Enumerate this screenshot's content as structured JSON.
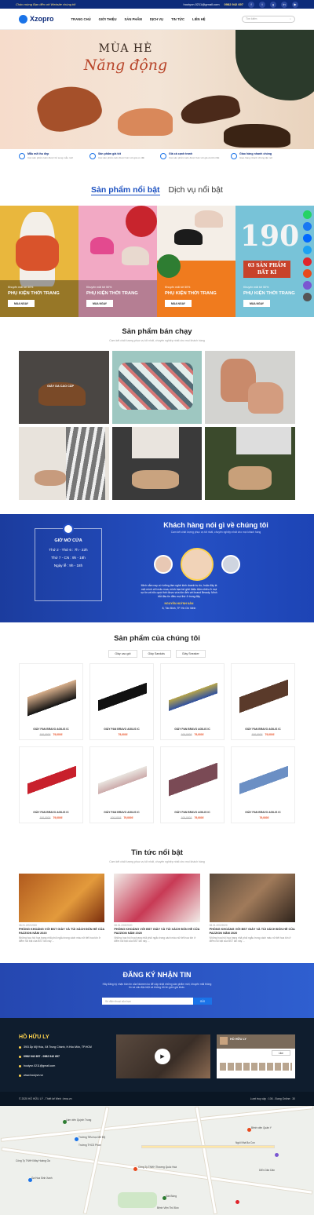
{
  "topbar": {
    "tagline": "Chào mừng Bạn đến với Website chúng tôi",
    "email": "houtyvn.0211@gmail.com",
    "phone": "0982 942 697",
    "socials": [
      "f",
      "t",
      "g",
      "in",
      "▶"
    ]
  },
  "nav": {
    "logo": "Xzopro",
    "items": [
      "TRANG CHỦ",
      "GIỚI THIỆU",
      "SẢN PHẨM",
      "DỊCH VỤ",
      "TIN TỨC",
      "LIÊN HỆ"
    ],
    "search_placeholder": "Tìm kiếm"
  },
  "hero": {
    "title": "MÙA HÈ",
    "subtitle": "Năng động"
  },
  "features": [
    {
      "title": "Mẫu mã thu đẹp",
      "desc": "Các sản phẩm luôn được bổ sung mẫu mới"
    },
    {
      "title": "Sản phẩm giá tốt",
      "desc": "Các sản phẩm luôn được bán với giá ưu đãi"
    },
    {
      "title": "Giá cả cạnh tranh",
      "desc": "Các sản phẩm luôn được bán với giá cả tốt nhất"
    },
    {
      "title": "Giao hàng nhanh chóng",
      "desc": "Giao hàng nhanh chóng tận nơi"
    }
  ],
  "tabs": {
    "active": "Sản phẩm nổi bật",
    "inactive": "Dịch vụ nổi bật"
  },
  "promos": [
    {
      "label": "Khuyến mãi tới 50%",
      "title": "PHỤ KIỆN THỜI TRANG",
      "button": "MUA NGAY",
      "color": "#e9b73d"
    },
    {
      "label": "Khuyến mãi tới 50%",
      "title": "PHỤ KIỆN THỜI TRANG",
      "button": "MUA NGAY",
      "color": "#f2a9c4"
    },
    {
      "label": "Khuyến mãi tới 50%",
      "title": "PHỤ KIỆN THỜI TRANG",
      "button": "MUA NGAY",
      "color": "#f07b1e"
    },
    {
      "label": "Khuyến mãi tới 50%",
      "title": "PHỤ KIỆN THỜI TRANG",
      "button": "MUA NGAY",
      "color": "#78c3d8",
      "big": "190",
      "big_sub": "03 SẢN PHẨM BẤT KÌ"
    }
  ],
  "bestseller": {
    "title": "Sản phẩm bán chạy",
    "subtitle": "Cam kết chất lượng phục vụ tốt nhất, chuyên nghiệp nhất cho mọi khách hàng",
    "tag": "GIÀY DA CAO CẤP"
  },
  "testimonial": {
    "hours_title": "GIỜ MỞ CỬA",
    "hours": [
      "Thứ 2 - Thứ 6 : 7h - 22h",
      "Thứ 7 - CN : 9h - 18h",
      "Ngày lễ : 9h - 18h"
    ],
    "title": "Khách hàng nói gì về chúng tôi",
    "subtitle": "Cam kết chất lượng phục vụ tốt nhất, chuyên nghiệp nhất cho mọi khách hàng",
    "quote": "Mình sắm nay cứ tưởng làm nghề kinh doanh tự do, hoặc đây là một mình cởi mấu mua, mình bạn bè giới thiệu tiệm nhiều ở mọi sự tin và hữu quá thời được vừa tôn đến với brand Beauty. Mình bắt đầu tin điều mọi thứ ở trong đây",
    "name": "NGUYỄN HUỲNH NÂN",
    "address": "8, Tân Bình, TP. Hồ Chí Minh"
  },
  "our_products": {
    "title": "Sản phẩm của chúng tôi",
    "tabs": [
      "Giày cao gót",
      "Giày Sandals",
      "Giày Sneaker"
    ],
    "items": [
      {
        "name": "GIÀY PAN BRAVO AGILIS IC",
        "old": "100,000₫",
        "new": "79,000₫"
      },
      {
        "name": "GIÀY PAN BRAVO AGILIS IC",
        "old": "",
        "new": "79,000₫"
      },
      {
        "name": "GIÀY PAN BRAVO AGILIS IC",
        "old": "100,000₫",
        "new": "79,000₫"
      },
      {
        "name": "GIÀY PAN BRAVO AGILIS IC",
        "old": "100,000₫",
        "new": "79,000₫"
      },
      {
        "name": "GIÀY PAN BRAVO AGILIS IC",
        "old": "100,000₫",
        "new": "79,000₫"
      },
      {
        "name": "GIÀY PAN BRAVO AGILIS IC",
        "old": "100,000₫",
        "new": "79,000₫"
      },
      {
        "name": "GIÀY PAN BRAVO AGILIS IC",
        "old": "100,000₫",
        "new": "79,000₫"
      },
      {
        "name": "GIÀY PAN BRAVO AGILIS IC",
        "old": "",
        "new": "79,000₫"
      }
    ]
  },
  "news": {
    "title": "Tin tức nổi bật",
    "subtitle": "Cam kết chất lượng phục vụ tốt nhất, chuyên nghiệp nhất cho mọi khách hàng",
    "items": [
      {
        "date": "08.31.2/02/2020",
        "title": "PHÒNG KHOÁNG VỚI BST GIÀY VÀ TÚI XÁCH ĐÓN HÈ CỦA PAZZION NĂM 2020",
        "excerpt": "Những hoa hồi hoa trang nhã phối ngẫu trong cách màu nữ tiết hoa tốn ở điểm nối bật của BST lần này ..."
      },
      {
        "date": "08.31.2/02/2020",
        "title": "PHÒNG KHOÁNG VỚI BST GIÀY VÀ TÚI XÁCH ĐÓN HÈ CỦA PAZZION NĂM 2020",
        "excerpt": "Những hoa hồi hoa trang nhã phối ngẫu trong cách màu nữ tiết hoa tốn ở điểm nối bật của BST lần này ..."
      },
      {
        "date": "08.31.2/02/2020",
        "title": "PHÒNG KHOÁNG VỚI BST GIÀY VÀ TÚI XÁCH ĐÓN HÈ CỦA PAZZION NĂM 2020",
        "excerpt": "Những hoa hồi hoa trang nhã phối ngẫu trong cách màu nữ tiết hoa tốn ở điểm nối bật của BST lần này ..."
      }
    ]
  },
  "newsletter": {
    "title": "ĐĂNG KÝ NHẬN TIN",
    "subtitle": "Hãy đăng ký nhận bản tin của Nuimen ko để cập nhật những sản phẩm mới, khuyến mãi thông tin và cấu đặc biệt và không bỏ tín gấm giá khác.",
    "placeholder": "Số điện thoại của bạn",
    "button": "GỬI"
  },
  "footer": {
    "brand": "HỒ HỮU LY",
    "address": "39/3 Ấp Mỹ Hòa, Xã Trung Chánh, H.Hóc Môn, TP.HCM",
    "phone": "0982 942 697 - 0982 942 697",
    "email": "houtyvn.0211@gmail.com",
    "web": "www.houlyvn.vn",
    "fb_name": "HỒ HỮU LY",
    "fb_button": "Like"
  },
  "copyright": {
    "left": "© 2020 HỒ HỮU LÝ - Thiết kế Web : lena.vn",
    "visits": "Lượt truy cập : 106 - Đang Online : 30"
  },
  "map": {
    "labels": [
      "Lâm viên Quỳnh Trung",
      "Trường Tiểu học Mê Mỹ",
      "Trường THCS Phan",
      "Bệnh viện Quân Y",
      "Ngôi Nhà Ba Con",
      "Công Ty TNHH Thương Quốc Hoà",
      "Sân Bóng",
      "Bệnh Viện Thủ Đức",
      "Ga Hoa Sinh Xanh",
      "Công Ty TNHH Mảy Hoàng Ga",
      "Diễn Dân Dân"
    ]
  }
}
